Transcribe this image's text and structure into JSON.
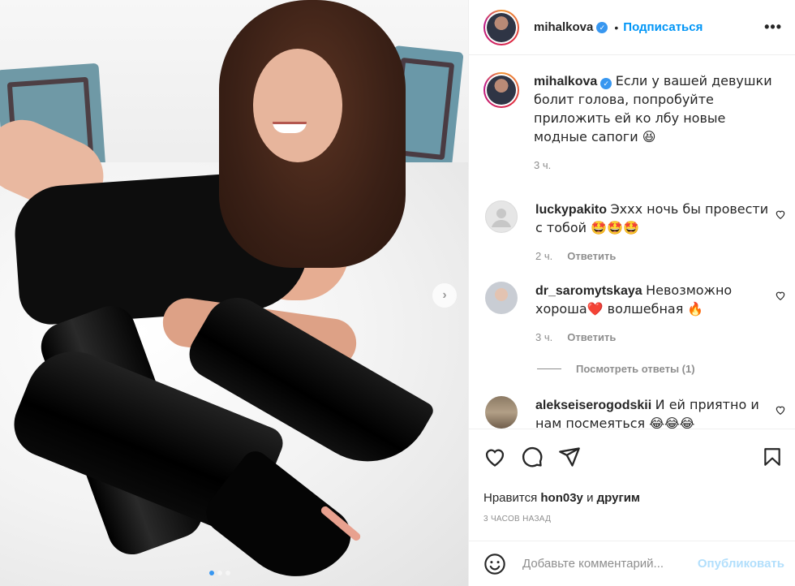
{
  "post": {
    "username": "mihalkova",
    "follow_label": "Подписаться",
    "bullet": "•",
    "more_label": "•••"
  },
  "caption": {
    "username": "mihalkova",
    "text": "Если у вашей девушки болит голова, попробуйте приложить ей ко лбу новые модные сапоги 😆",
    "time": "3 ч."
  },
  "comments": [
    {
      "username": "luckypakito",
      "text": "Эххх ночь бы провести с тобой 🤩🤩🤩",
      "time": "2 ч.",
      "reply_label": "Ответить"
    },
    {
      "username": "dr_saromytskaya",
      "text": "Невозможно хороша❤️ волшебная 🔥",
      "time": "3 ч.",
      "reply_label": "Ответить"
    },
    {
      "username": "alekseiserogodskii",
      "text": "И ей приятно и нам посмеяться 😂😂😂"
    }
  ],
  "view_replies_label": "Посмотреть ответы (1)",
  "likes": {
    "prefix": "Нравится",
    "user": "hon03y",
    "connector": "и",
    "others": "другим"
  },
  "posted_time": "3 ЧАСОВ НАЗАД",
  "add_comment": {
    "placeholder": "Добавьте комментарий...",
    "publish_label": "Опубликовать"
  },
  "carousel": {
    "slides": 3,
    "active_index": 0
  },
  "colors": {
    "accent": "#0095f6",
    "verified": "#3897f0",
    "muted": "#8e8e8e",
    "publish_disabled": "#b2dffc"
  },
  "icons": [
    "like-icon",
    "comment-icon",
    "share-icon",
    "save-icon",
    "emoji-icon",
    "next-arrow-icon",
    "verified-icon",
    "heart-icon"
  ]
}
